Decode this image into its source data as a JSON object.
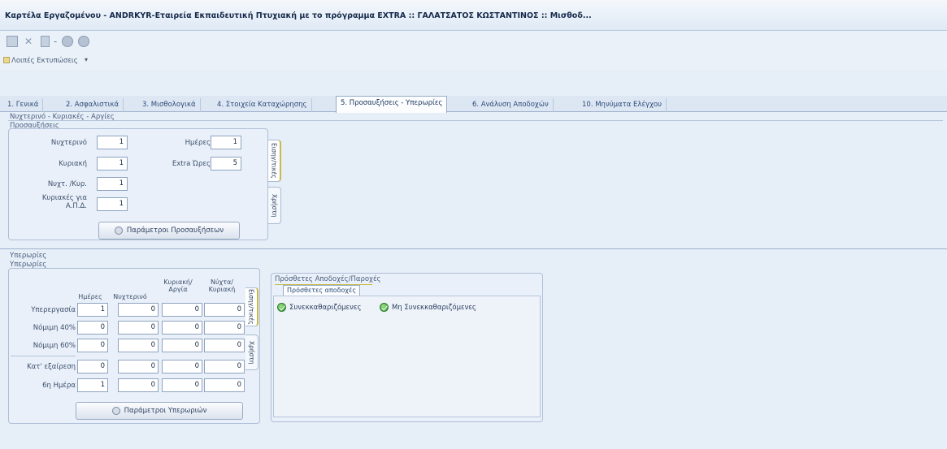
{
  "window": {
    "title": "Καρτέλα Εργαζομένου - ANDRKYR-Εταιρεία Εκπαιδευτική Πτυχιακή με το πρόγραμμα EXTRA :: ΓΑΛΑΤΣΑΤΟΣ ΚΩΣΤΑΝΤΙΝΟΣ :: Μισθοδ..."
  },
  "toolbar": {
    "icons": [
      "save-icon",
      "delete-icon",
      "document-icon",
      "circle-icon",
      "circle-icon"
    ]
  },
  "print_menu": {
    "label": "Λοιπές Εκτυπώσεις",
    "arrow": "▾"
  },
  "tabs": [
    "1. Γενικά",
    "2. Ασφαλιστικά",
    "3. Μισθολογικά",
    "4. Στοιχεία Καταχώρησης",
    "5. Προσαυξήσεις - Υπερωρίες",
    "6. Ανάλυση Αποδοχών",
    "10. Μηνύματα Ελέγχου"
  ],
  "night_section": {
    "header": "Νυχτερινό - Κυριακές - Αργίες",
    "group_label": "Προσαυξήσεις",
    "fields": [
      {
        "label": "Νυχτερινό",
        "value": "1"
      },
      {
        "label": "Κυριακή",
        "value": "1"
      },
      {
        "label": "Νυχτ. /Κυρ.",
        "value": "1"
      },
      {
        "label": "Κυριακές για",
        "label2": "Α.Π.Δ.",
        "value": "1"
      }
    ],
    "fields_right": [
      {
        "label": "Ημέρες",
        "value": "1"
      },
      {
        "label": "Extra Ώρες",
        "value": "5"
      }
    ],
    "button": "Παράμετροι Προσαυξήσεων",
    "side_tabs": [
      "Εισηγ/τικές",
      "Χρήστη"
    ]
  },
  "overtime_section": {
    "header": "Υπερωρίες",
    "group_label": "Υπερωρίες",
    "columns": [
      "Ημέρες",
      "Νυχτερινό",
      "Κυριακή/ Αργία",
      "Νύχτα/ Κυριακή"
    ],
    "rows": [
      {
        "label": "Υπερεργασία",
        "values": [
          "1",
          "0",
          "0",
          "0"
        ]
      },
      {
        "label": "Νόμιμη 40%",
        "values": [
          "0",
          "0",
          "0",
          "0"
        ]
      },
      {
        "label": "Νόμιμη 60%",
        "values": [
          "0",
          "0",
          "0",
          "0"
        ]
      },
      {
        "label": "Κατ' εξαίρεση",
        "values": [
          "0",
          "0",
          "0",
          "0"
        ]
      },
      {
        "label": "6η Ημέρα",
        "values": [
          "1",
          "0",
          "0",
          "0"
        ]
      }
    ],
    "button": "Παράμετροι Υπερωριών",
    "side_tabs": [
      "Εισηγ/τικές",
      "Χρήστη"
    ]
  },
  "extra_pay": {
    "header": "Πρόσθετες Αποδοχές/Παροχές",
    "tab": "Πρόσθετες αποδοχές",
    "options": [
      "Συνεκκαθαριζόμενες",
      "Μη Συνεκκαθαριζόμενες"
    ]
  }
}
